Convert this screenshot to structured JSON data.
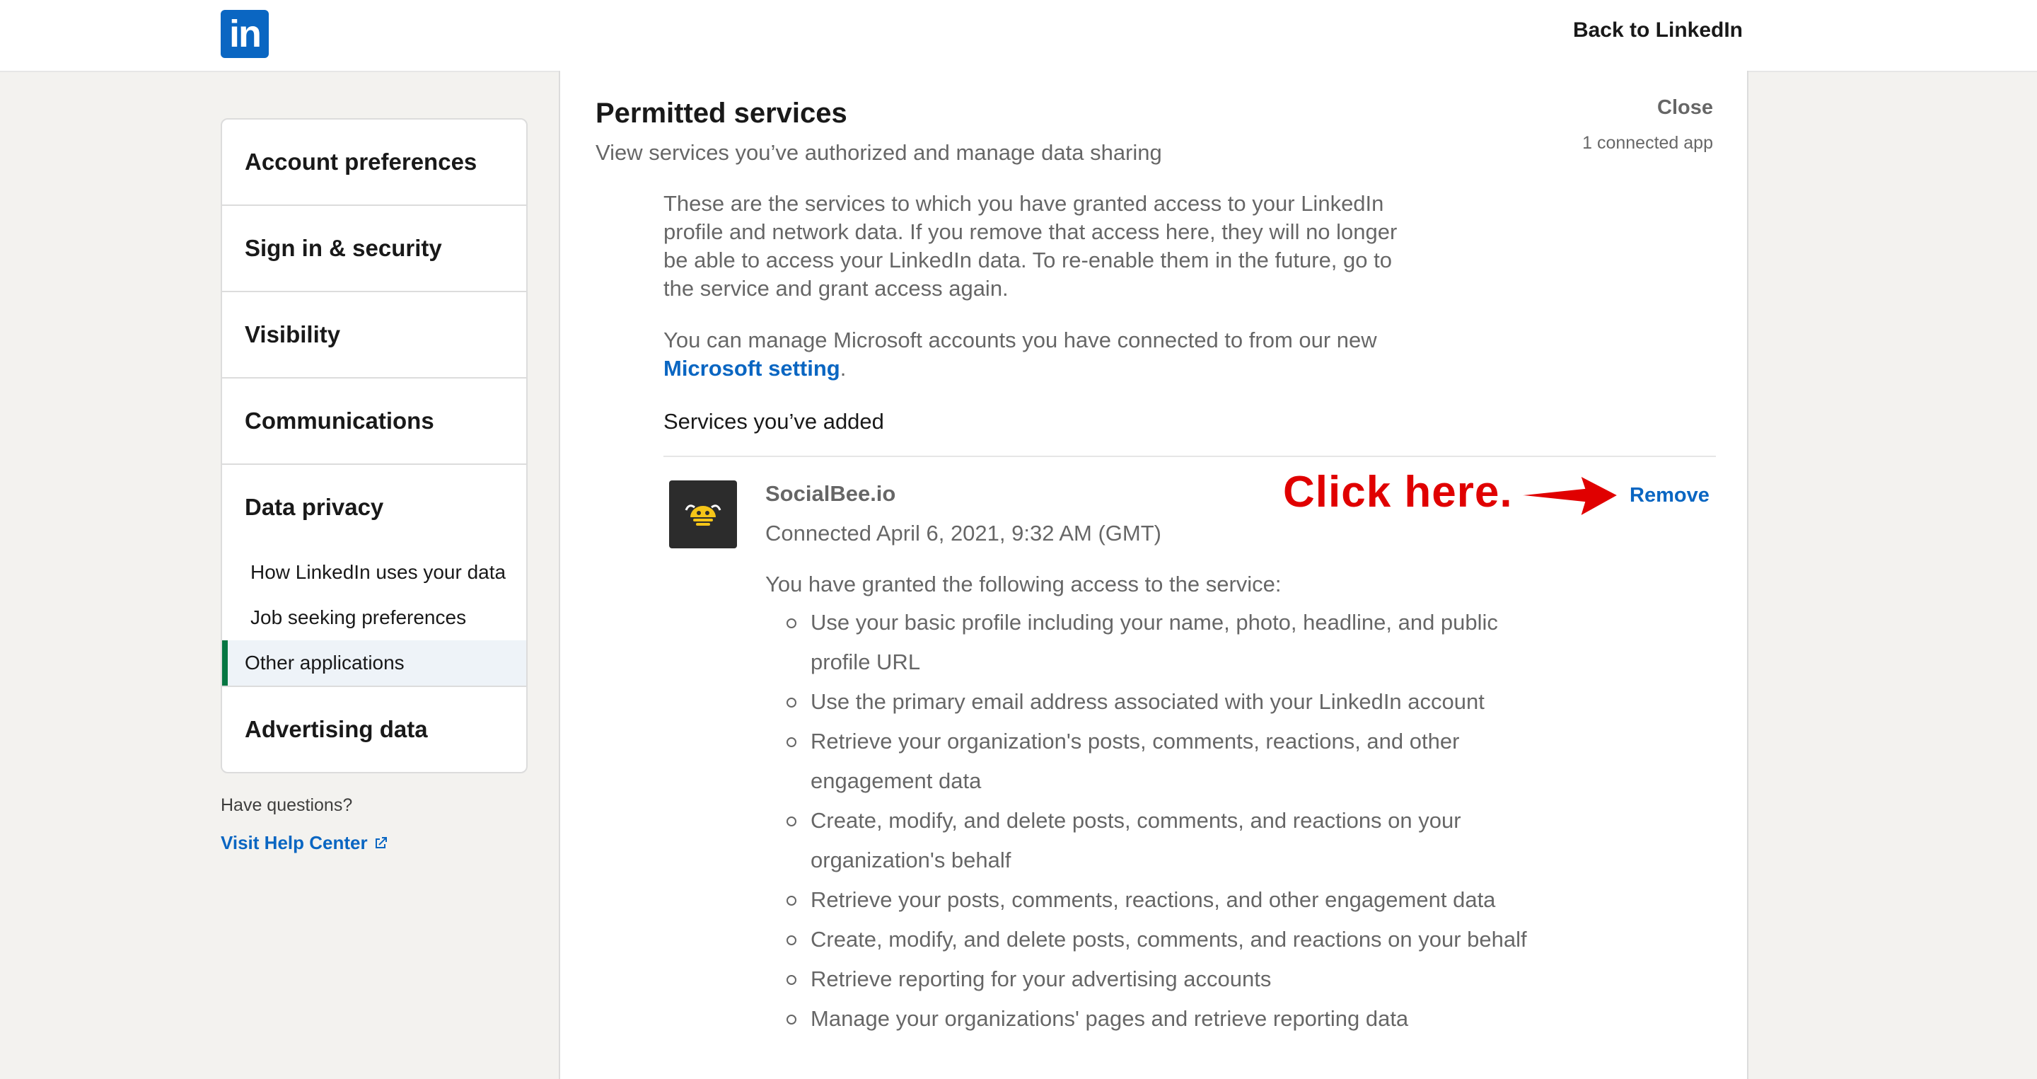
{
  "header": {
    "logo_text": "in",
    "back_link": "Back to LinkedIn",
    "brand_color": "#0a66c2"
  },
  "sidebar": {
    "items": [
      {
        "label": "Account preferences"
      },
      {
        "label": "Sign in & security"
      },
      {
        "label": "Visibility"
      },
      {
        "label": "Communications"
      }
    ],
    "data_privacy": {
      "label": "Data privacy",
      "subitems": [
        {
          "label": "How LinkedIn uses your data"
        },
        {
          "label": "Job seeking preferences"
        },
        {
          "label": "Other applications",
          "active": true
        }
      ]
    },
    "last_item": {
      "label": "Advertising data"
    },
    "help_question": "Have questions?",
    "help_link": "Visit Help Center",
    "help_link_icon": "external-link-icon"
  },
  "main": {
    "title": "Permitted services",
    "subtitle": "View services you’ve authorized and manage data sharing",
    "close_label": "Close",
    "connected_count": "1 connected app",
    "paragraph1": "These are the services to which you have granted access to your LinkedIn profile and network data. If you remove that access here, they will no longer be able to access your LinkedIn data. To re-enable them in the future, go to the service and grant access again.",
    "paragraph2_prefix": "You can manage Microsoft accounts you have connected to from our new",
    "paragraph2_link": "Microsoft setting",
    "paragraph2_suffix": ".",
    "services_heading": "Services you’ve added",
    "service": {
      "name": "SocialBee.io",
      "connected": "Connected April 6, 2021, 9:32 AM (GMT)",
      "remove_label": "Remove",
      "granted_intro": "You have granted the following access to the service:",
      "permissions": [
        "Use your basic profile including your name, photo, headline, and public profile URL",
        "Use the primary email address associated with your LinkedIn account",
        "Retrieve your organization's posts, comments, reactions, and other engagement data",
        "Create, modify, and delete posts, comments, and reactions on your organization's behalf",
        "Retrieve your posts, comments, reactions, and other engagement data",
        "Create, modify, and delete posts, comments, and reactions on your behalf",
        "Retrieve reporting for your advertising accounts",
        "Manage your organizations' pages and retrieve reporting data"
      ]
    },
    "annotation": "Click here."
  }
}
